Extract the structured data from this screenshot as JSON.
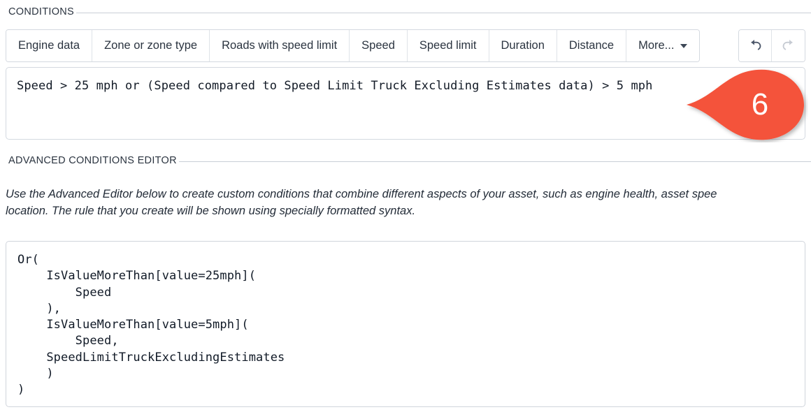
{
  "sections": {
    "conditions": {
      "title": "CONDITIONS"
    },
    "advanced": {
      "title": "ADVANCED CONDITIONS EDITOR"
    }
  },
  "toolbar": {
    "buttons": [
      {
        "label": "Engine data",
        "name": "engine-data"
      },
      {
        "label": "Zone or zone type",
        "name": "zone-or-zone-type"
      },
      {
        "label": "Roads with speed limit",
        "name": "roads-with-speed-limit"
      },
      {
        "label": "Speed",
        "name": "speed"
      },
      {
        "label": "Speed limit",
        "name": "speed-limit"
      },
      {
        "label": "Duration",
        "name": "duration"
      },
      {
        "label": "Distance",
        "name": "distance"
      }
    ],
    "more": {
      "label": "More...",
      "icon": "chevron-down-icon"
    },
    "undo": {
      "icon": "undo-icon",
      "enabled": true
    },
    "redo": {
      "icon": "redo-icon",
      "enabled": false
    }
  },
  "condition": {
    "expression": "Speed > 25 mph or (Speed compared to Speed Limit Truck Excluding Estimates data) > 5 mph"
  },
  "callout": {
    "number": "6",
    "color": "#F4523B",
    "shape": "teardrop-pointer-left"
  },
  "advanced_editor": {
    "description_line1": "Use the Advanced Editor below to create custom conditions that combine different aspects of your asset, such as engine health, asset spee",
    "description_line2": "location. The rule that you create will be shown using specially formatted syntax.",
    "code": "Or(\n    IsValueMoreThan[value=25mph](\n        Speed\n    ),\n    IsValueMoreThan[value=5mph](\n        Speed,\n    SpeedLimitTruckExcludingEstimates\n    )\n)"
  },
  "colors": {
    "accent": "#F4523B",
    "text": "#1a2332",
    "border": "#d4d9e0",
    "rule": "#c9ced6",
    "icon_enabled": "#4a5568",
    "icon_disabled": "#c5cad2"
  }
}
